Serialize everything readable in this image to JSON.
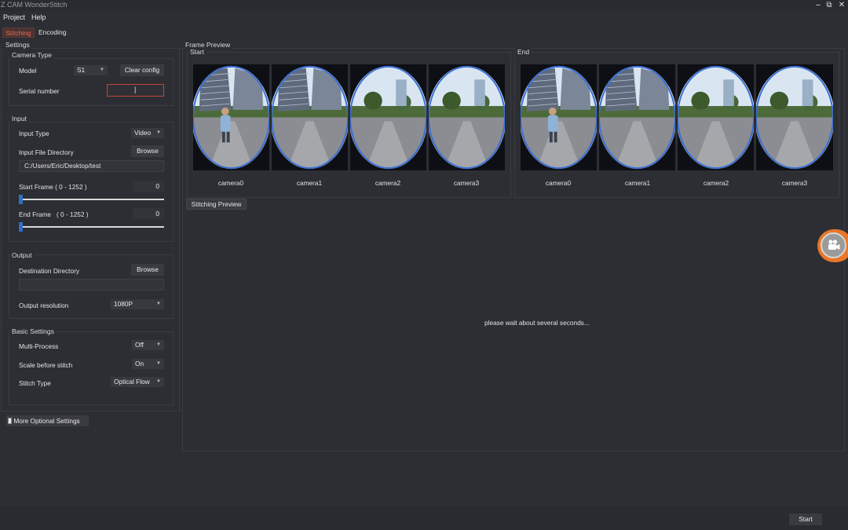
{
  "window": {
    "title": "Z CAM WonderStitch",
    "minimize": "–",
    "restore": "⧉",
    "close": "✕"
  },
  "menu": [
    {
      "label": "Project"
    },
    {
      "label": "Help"
    }
  ],
  "tabs": [
    {
      "label": "Stitching",
      "active": true
    },
    {
      "label": "Encoding",
      "active": false
    }
  ],
  "settings": {
    "title": "Settings",
    "camera_type": {
      "title": "Camera Type",
      "model_label": "Model",
      "model_value": "S1",
      "clear_config": "Clear config",
      "serial_label": "Serial number",
      "serial_value": "|"
    },
    "input": {
      "title": "Input",
      "input_type_label": "Input Type",
      "input_type_value": "Video",
      "dir_label": "Input File Directory",
      "browse": "Browse",
      "dir_value": "C:/Users/Eric/Desktop/test",
      "start_label": "Start Frame ( 0 - 1252 )",
      "start_value": "0",
      "end_label": "End Frame   ( 0 - 1252 )",
      "end_value": "0",
      "start_slider": 0,
      "end_slider": 0
    },
    "output": {
      "title": "Output",
      "dest_label": "Destination Directory",
      "browse": "Browse",
      "dest_value": "",
      "res_label": "Output resolution",
      "res_value": "1080P"
    },
    "basic": {
      "title": "Basic Settings",
      "multi_label": "Multi-Process",
      "multi_value": "Off",
      "scale_label": "Scale before stitch",
      "scale_value": "On",
      "stitch_label": "Stitch Type",
      "stitch_value": "Optical Flow"
    },
    "more_optional": "More Optional Settings"
  },
  "frame_preview": {
    "title": "Frame Preview",
    "start_title": "Start",
    "end_title": "End",
    "cameras": [
      "camera0",
      "camera1",
      "camera2",
      "camera3"
    ]
  },
  "stitching_preview": {
    "tab": "Stitching Preview",
    "message": "please wait about several seconds..."
  },
  "footer": {
    "start_button": "Start"
  },
  "colors": {
    "accent": "#e06c5c",
    "slider": "#2f6fc7",
    "fab": "#e8772a",
    "background": "#2d2e33"
  }
}
